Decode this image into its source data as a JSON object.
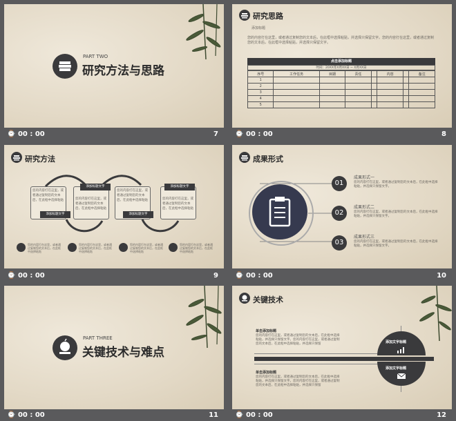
{
  "slides": [
    {
      "part": "PART TWO",
      "title": "研究方法与思路",
      "time": "00 : 00",
      "num": "7"
    },
    {
      "heading": "研究思路",
      "sub": "添加标题",
      "para": "您的内容打在这里，或者通过复制您的文本后，在此框中选择粘贴，并选择只保留文字。您的内容打在这里，或者通过复制您的文本后，在此框中选择粘贴，并选择只保留文字。",
      "table_title": "点击添加标题",
      "table_time": "时间：20XX年X月XX日 ~ X月XX日",
      "cols": [
        "序号",
        "工作任务",
        "目期",
        "责任",
        "",
        "内容",
        "",
        "备注"
      ],
      "rows": [
        "1",
        "2",
        "3",
        "4",
        "5"
      ],
      "time": "00 : 00",
      "num": "8"
    },
    {
      "heading": "研究方法",
      "box_text": "您的内容打在这里，或者通过复制您的文本后，在此框中选择粘贴",
      "labels": [
        "添加标题文字",
        "添加标题文字",
        "添加标题文字",
        "添加标题文字"
      ],
      "bottom_text": "您的内容打在这里，或者通过复制您的文本后，在此框中选择粘贴",
      "time": "00 : 00",
      "num": "9"
    },
    {
      "heading": "成果形式",
      "items": [
        {
          "n": "01",
          "t": "成果形式一",
          "d": "您的内容打在这里，或者通过复制您的文本后，在此框中选择粘贴，并选择只保留文字。"
        },
        {
          "n": "02",
          "t": "成果形式二",
          "d": "您的内容打在这里，或者通过复制您的文本后，在此框中选择粘贴，并选择只保留文字。"
        },
        {
          "n": "03",
          "t": "成果形式三",
          "d": "您的内容打在这里，或者通过复制您的文本后，在此框中选择粘贴，并选择只保留文字。"
        }
      ],
      "time": "00 : 00",
      "num": "10"
    },
    {
      "part": "PART THREE",
      "title": "关键技术与难点",
      "time": "00 : 00",
      "num": "11"
    },
    {
      "heading": "关键技术",
      "blocks": [
        {
          "t": "单击添加标题",
          "d": "您的内容打在这里，或者通过复制您的文本后，在此框中选择粘贴，并选择只保留文字。您的内容打在这里，或者通过复制您的文本后，在此框中选择粘贴，并选择只保留"
        },
        {
          "t": "单击添加标题",
          "d": "您的内容打在这里，或者通过复制您的文本后，在此框中选择粘贴，并选择只保留文字。您的内容打在这里，或者通过复制您的文本后，在此框中选择粘贴，并选择只保留"
        }
      ],
      "circle_labels": [
        "添加文字标题",
        "添加文字标题"
      ],
      "time": "00 : 00",
      "num": "12"
    }
  ],
  "icons": [
    "books-icon",
    "clipboard-icon",
    "apple-icon",
    "chart-icon",
    "mail-icon",
    "speech-bubble-icon",
    "quote-icon",
    "comments-icon"
  ]
}
